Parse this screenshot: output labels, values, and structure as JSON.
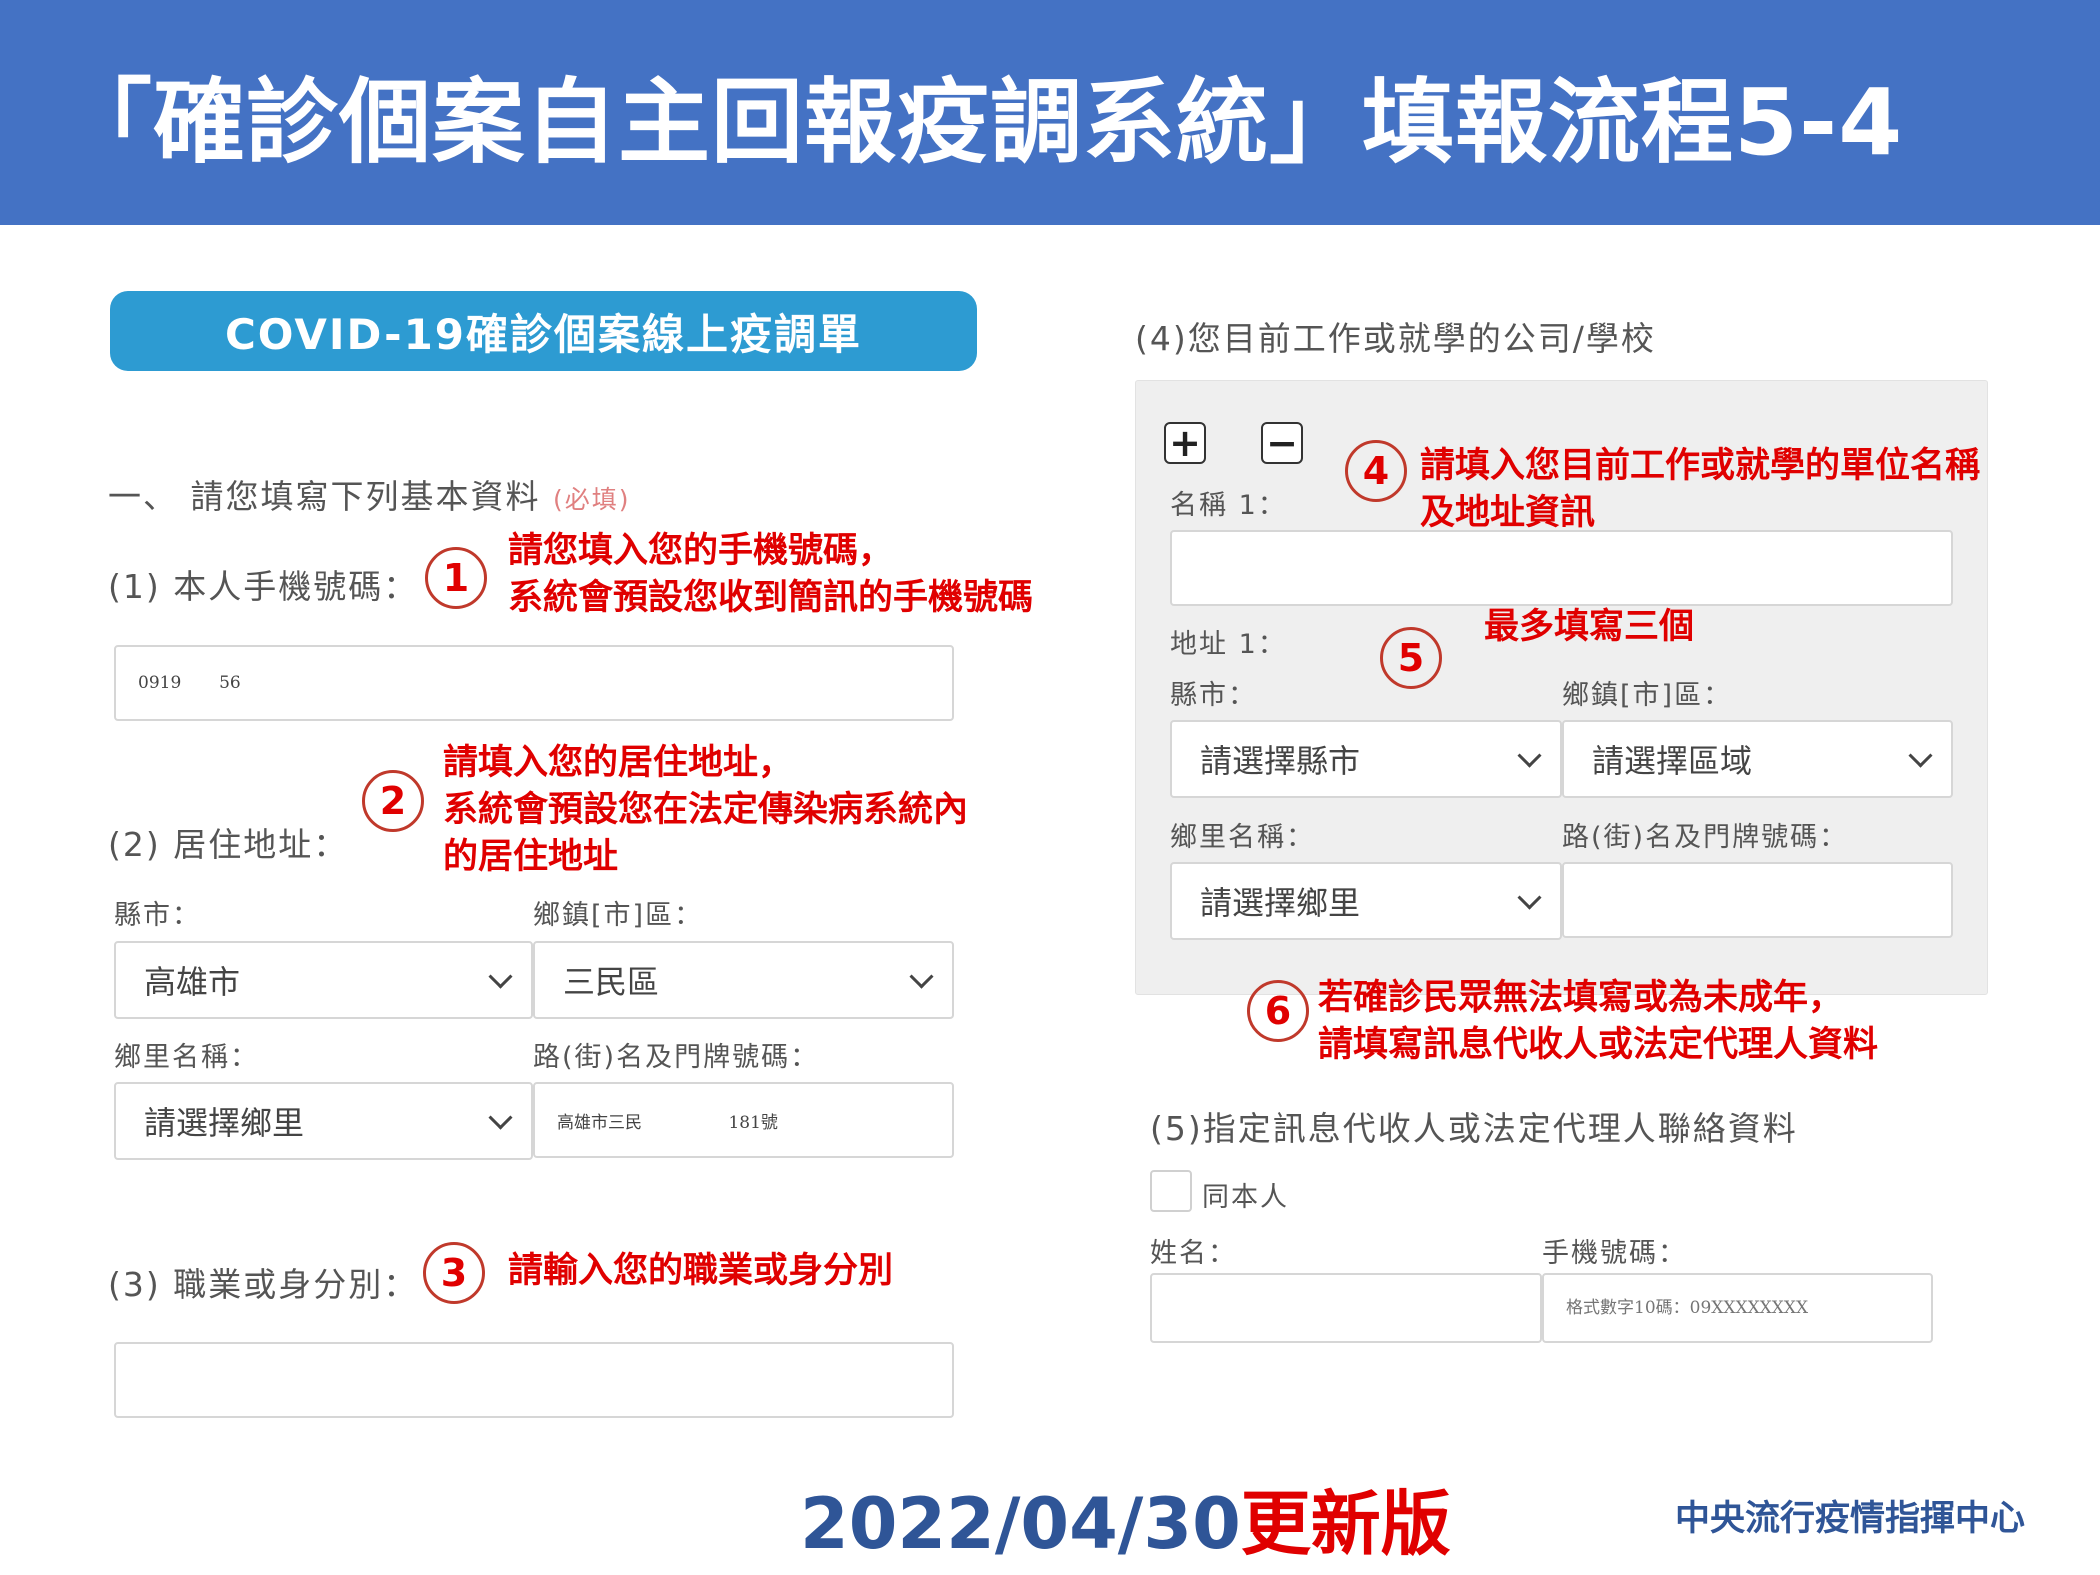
{
  "header": {
    "title": "「確診個案自主回報疫調系統」填報流程5-4"
  },
  "banner": {
    "title": "COVID-19確診個案線上疫調單"
  },
  "section1": {
    "title": "一、 請您填寫下列基本資料",
    "required": "(必填)",
    "phone": {
      "label": "(1) 本人手機號碼：",
      "value": "0919       56"
    },
    "address": {
      "label": "(2) 居住地址：",
      "county_label": "縣市：",
      "county_value": "高雄市",
      "district_label": "鄉鎮[市]區：",
      "district_value": "三民區",
      "village_label": "鄉里名稱：",
      "village_value": "請選擇鄉里",
      "road_label": "路(街)名及門牌號碼：",
      "road_value": "高雄市三民                181號"
    },
    "occupation": {
      "label": "(3) 職業或身分別：",
      "value": ""
    }
  },
  "section4": {
    "label": "(4)您目前工作或就學的公司/學校",
    "add_symbol": "+",
    "remove_symbol": "−",
    "name_label": "名稱 1：",
    "name_value": "",
    "address_label": "地址 1：",
    "county_label": "縣市：",
    "county_value": "請選擇縣市",
    "district_label": "鄉鎮[市]區：",
    "district_value": "請選擇區域",
    "village_label": "鄉里名稱：",
    "village_value": "請選擇鄉里",
    "road_label": "路(街)名及門牌號碼：",
    "road_value": ""
  },
  "section5": {
    "label": "(5)指定訊息代收人或法定代理人聯絡資料",
    "same_label": "同本人",
    "name_label": "姓名：",
    "name_value": "",
    "phone_label": "手機號碼：",
    "phone_placeholder": "格式數字10碼：09XXXXXXXX"
  },
  "annotations": [
    {
      "num": "1",
      "lines": [
        "請您填入您的手機號碼，",
        "系統會預設您收到簡訊的手機號碼"
      ]
    },
    {
      "num": "2",
      "lines": [
        "請填入您的居住地址，",
        "系統會預設您在法定傳染病系統內",
        "的居住地址"
      ]
    },
    {
      "num": "3",
      "lines": [
        "請輸入您的職業或身分別"
      ]
    },
    {
      "num": "4",
      "lines": [
        "請填入您目前工作或就學的單位名稱",
        "及地址資訊"
      ]
    },
    {
      "num": "5",
      "lines": [
        "最多填寫三個"
      ]
    },
    {
      "num": "6",
      "lines": [
        "若確診民眾無法填寫或為未成年，",
        "請填寫訊息代收人或法定代理人資料"
      ]
    }
  ],
  "footer": {
    "date": "2022/04/30",
    "date_suffix": "更新版",
    "org": "中央流行疫情指揮中心"
  },
  "colors": {
    "header_bg": "#4472c4",
    "banner_bg": "#2d9bd2",
    "annotation_red": "#e00000",
    "footer_blue": "#2f5597"
  }
}
